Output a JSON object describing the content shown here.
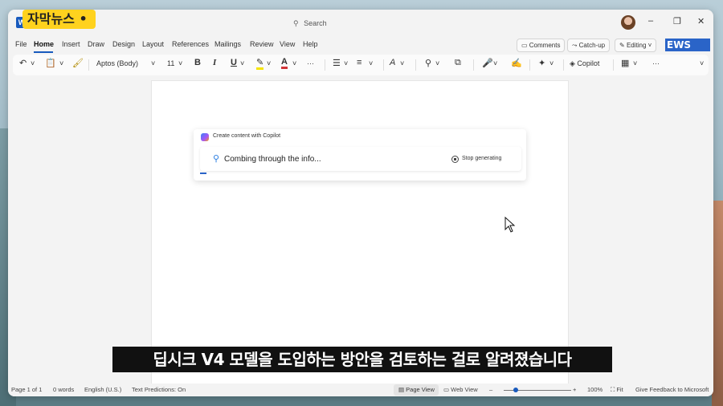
{
  "overlay": {
    "channel_badge": "자막뉴스 •",
    "subtitle": "딥시크 V4 모델을 도입하는 방안을 검토하는 걸로 알려졌습니다",
    "news_logo": "EWS"
  },
  "titlebar": {
    "app_icon": "W",
    "search_placeholder": "Search",
    "minimize": "–",
    "restore": "❐",
    "close": "✕"
  },
  "menu": {
    "tabs": [
      "File",
      "Home",
      "Insert",
      "Draw",
      "Design",
      "Layout",
      "References",
      "Mailings",
      "Review",
      "View",
      "Help"
    ],
    "active_tab": "Home",
    "comments_label": "Comments",
    "catchup_label": "Catch-up",
    "editing_label": "Editing"
  },
  "ribbon": {
    "font_name": "Aptos (Body)",
    "font_size": "11",
    "bold": "B",
    "italic": "I",
    "underline": "U",
    "font_color": "A",
    "more": "···",
    "copilot_label": "Copilot"
  },
  "copilot": {
    "card_title": "Create content with Copilot",
    "status_text": "Combing through the info...",
    "stop_label": "Stop generating"
  },
  "statusbar": {
    "page": "Page 1 of 1",
    "words": "0 words",
    "language": "English (U.S.)",
    "predictions": "Text Predictions: On",
    "page_view": "Page View",
    "web_view": "Web View",
    "zoom_minus": "–",
    "zoom_plus": "+",
    "zoom": "100%",
    "fit": "Fit",
    "feedback": "Give Feedback to Microsoft",
    "zoom_level": 0.18
  },
  "colors": {
    "accent": "#185abd",
    "badge": "#ffd21e"
  }
}
